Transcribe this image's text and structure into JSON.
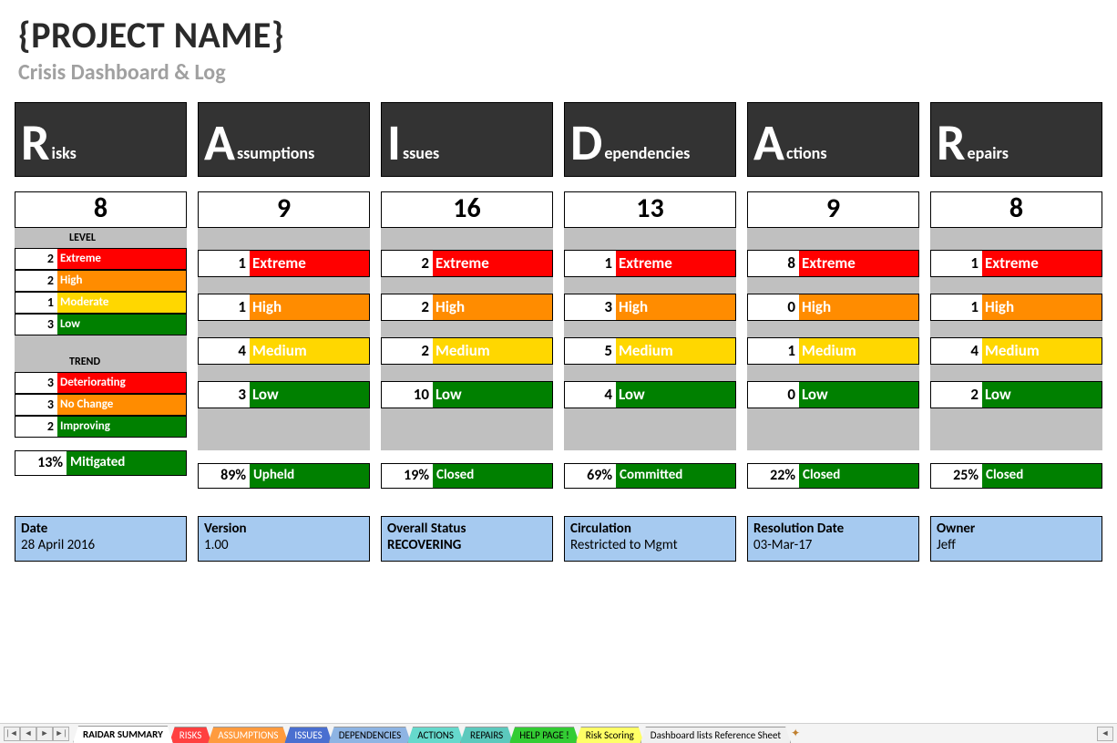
{
  "header": {
    "title": "{PROJECT NAME}",
    "subtitle": "Crisis Dashboard & Log"
  },
  "labels": {
    "level": "LEVEL",
    "trend": "TREND"
  },
  "colors": {
    "extreme": "#ff0000",
    "high": "#ff8c00",
    "moderate": "#ffd700",
    "low": "#008000",
    "header_bg": "#333333",
    "gray": "#c0c0c0",
    "info_bg": "#a6caf0"
  },
  "columns": [
    {
      "big": "R",
      "rest": "isks",
      "total": "8",
      "levels": [
        {
          "n": "2",
          "lbl": "Extreme",
          "cls": "red"
        },
        {
          "n": "2",
          "lbl": "High",
          "cls": "orange"
        },
        {
          "n": "1",
          "lbl": "Moderate",
          "cls": "yellow"
        },
        {
          "n": "3",
          "lbl": "Low",
          "cls": "green"
        }
      ],
      "trend": [
        {
          "n": "3",
          "lbl": "Deteriorating",
          "cls": "red"
        },
        {
          "n": "3",
          "lbl": "No Change",
          "cls": "orange"
        },
        {
          "n": "2",
          "lbl": "Improving",
          "cls": "green"
        }
      ],
      "pct": {
        "n": "13%",
        "lbl": "Mitigated"
      }
    },
    {
      "big": "A",
      "rest": "ssumptions",
      "total": "9",
      "levels": [
        {
          "n": "1",
          "lbl": "Extreme",
          "cls": "red"
        },
        {
          "n": "1",
          "lbl": "High",
          "cls": "orange"
        },
        {
          "n": "4",
          "lbl": "Medium",
          "cls": "yellow"
        },
        {
          "n": "3",
          "lbl": "Low",
          "cls": "green"
        }
      ],
      "pct": {
        "n": "89%",
        "lbl": "Upheld"
      }
    },
    {
      "big": "I",
      "rest": "ssues",
      "total": "16",
      "levels": [
        {
          "n": "2",
          "lbl": "Extreme",
          "cls": "red"
        },
        {
          "n": "2",
          "lbl": "High",
          "cls": "orange"
        },
        {
          "n": "2",
          "lbl": "Medium",
          "cls": "yellow"
        },
        {
          "n": "10",
          "lbl": "Low",
          "cls": "green"
        }
      ],
      "pct": {
        "n": "19%",
        "lbl": "Closed"
      }
    },
    {
      "big": "D",
      "rest": "ependencies",
      "total": "13",
      "levels": [
        {
          "n": "1",
          "lbl": "Extreme",
          "cls": "red"
        },
        {
          "n": "3",
          "lbl": "High",
          "cls": "orange"
        },
        {
          "n": "5",
          "lbl": "Medium",
          "cls": "yellow"
        },
        {
          "n": "4",
          "lbl": "Low",
          "cls": "green"
        }
      ],
      "pct": {
        "n": "69%",
        "lbl": "Committed"
      }
    },
    {
      "big": "A",
      "rest": "ctions",
      "total": "9",
      "levels": [
        {
          "n": "8",
          "lbl": "Extreme",
          "cls": "red"
        },
        {
          "n": "0",
          "lbl": "High",
          "cls": "orange"
        },
        {
          "n": "1",
          "lbl": "Medium",
          "cls": "yellow"
        },
        {
          "n": "0",
          "lbl": "Low",
          "cls": "green"
        }
      ],
      "pct": {
        "n": "22%",
        "lbl": "Closed"
      }
    },
    {
      "big": "R",
      "rest": "epairs",
      "total": "8",
      "levels": [
        {
          "n": "1",
          "lbl": "Extreme",
          "cls": "red"
        },
        {
          "n": "1",
          "lbl": "High",
          "cls": "orange"
        },
        {
          "n": "4",
          "lbl": "Medium",
          "cls": "yellow"
        },
        {
          "n": "2",
          "lbl": "Low",
          "cls": "green"
        }
      ],
      "pct": {
        "n": "25%",
        "lbl": "Closed"
      }
    }
  ],
  "info": [
    {
      "lbl": "Date",
      "val": "28 April 2016",
      "bold": false
    },
    {
      "lbl": "Version",
      "val": "1.00",
      "bold": false
    },
    {
      "lbl": "Overall Status",
      "val": "RECOVERING",
      "bold": true
    },
    {
      "lbl": "Circulation",
      "val": "Restricted to Mgmt",
      "bold": false
    },
    {
      "lbl": "Resolution Date",
      "val": "03-Mar-17",
      "bold": false
    },
    {
      "lbl": "Owner",
      "val": "Jeff",
      "bold": false
    }
  ],
  "tabs": [
    {
      "lbl": "RAIDAR SUMMARY",
      "cls": "active"
    },
    {
      "lbl": "RISKS",
      "cls": "tab-red"
    },
    {
      "lbl": "ASSUMPTIONS",
      "cls": "tab-orange"
    },
    {
      "lbl": "ISSUES",
      "cls": "tab-blue"
    },
    {
      "lbl": "DEPENDENCIES",
      "cls": "tab-lblue"
    },
    {
      "lbl": "ACTIONS",
      "cls": "tab-teal"
    },
    {
      "lbl": "REPAIRS",
      "cls": "tab-teal2"
    },
    {
      "lbl": "HELP PAGE !",
      "cls": "tab-green"
    },
    {
      "lbl": "Risk Scoring",
      "cls": "tab-yellow"
    },
    {
      "lbl": "Dashboard lists Reference Sheet",
      "cls": "tab-plain"
    }
  ]
}
